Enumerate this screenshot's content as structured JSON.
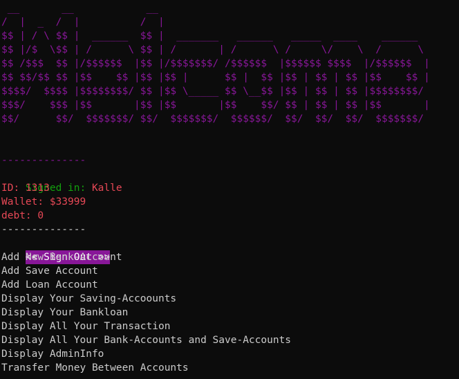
{
  "banner": {
    "ascii_art": " __       __            __                                              \n/  |  _  /  |          /  |                                             \n$$ | / \\ $$ |  ______  $$ |  _______   ______   _____  ____    ______  \n$$ |/$  \\$$ | /      \\ $$ | /       | /      \\ /     \\/    \\  /      \\ \n$$ /$$$  $$ |/$$$$$$  |$$ |/$$$$$$$/ /$$$$$$  |$$$$$$ $$$$  |/$$$$$$  |\n$$ $$/$$ $$ |$$    $$ |$$ |$$ |      $$ |  $$ |$$ | $$ | $$ |$$    $$ |\n$$$$/  $$$$ |$$$$$$$$/ $$ |$$ \\_____ $$ \\__$$ |$$ | $$ | $$ |$$$$$$$$/ \n$$$/    $$$ |$$       |$$ |$$       |$$    $$/ $$ | $$ | $$ |$$       |\n$$/      $$/  $$$$$$$/ $$/  $$$$$$$/  $$$$$$/  $$/  $$/  $$/  $$$$$$$/ "
  },
  "divider_top": "--------------",
  "session": {
    "signed_in_label": "Signed in: ",
    "user_name": "Kalle",
    "id_text": "ID: 1313",
    "wallet_text": "Wallet: $33999",
    "debt_text": "debt: 0"
  },
  "divider_bottom": "--------------",
  "menu": {
    "selected_item": "<< Sign Out >>",
    "items": [
      "Add New Bank-Account",
      "Add Save Account",
      "Add Loan Account",
      "Display Your Saving-Accoounts",
      "Display Your Bankloan",
      "Display All Your Transaction",
      "Display All Your Bank-Accounts and Save-Accounts",
      "Display AdminInfo",
      "Transfer Money Between Accounts"
    ]
  },
  "colors": {
    "background": "#0c0c0c",
    "text": "#cccccc",
    "magenta": "#881798",
    "green": "#13a10e",
    "red": "#e74856"
  }
}
